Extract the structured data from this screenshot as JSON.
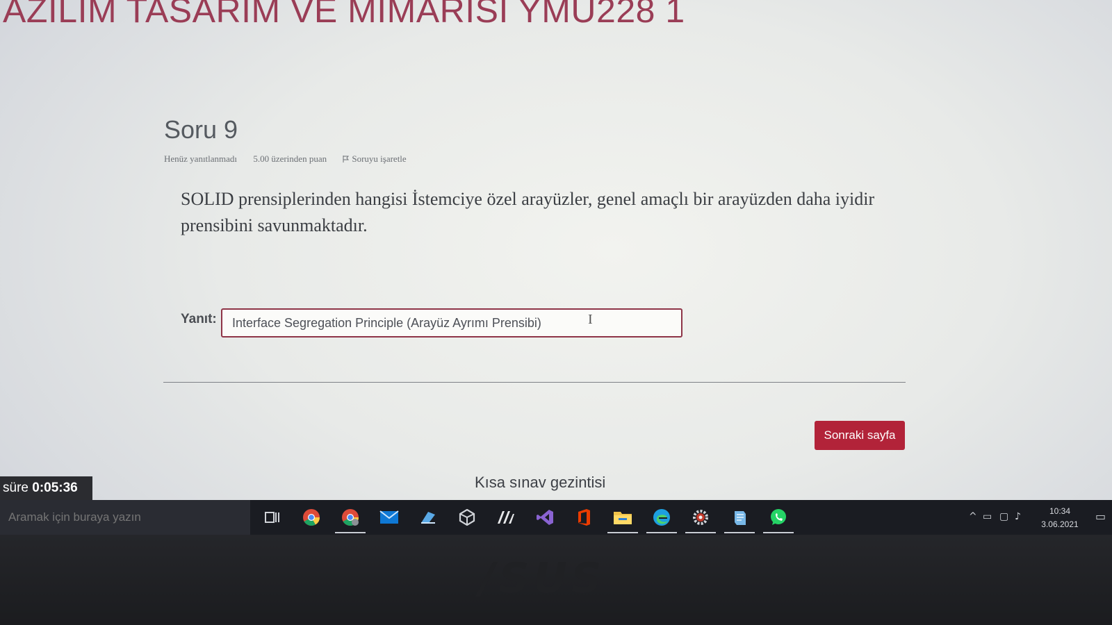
{
  "course": {
    "title": "AZILIM TASARIM VE MIMARISI YMU228 1"
  },
  "question": {
    "heading": "Soru 9",
    "status": "Henüz yanıtlanmadı",
    "points": "5.00 üzerinden puan",
    "flag_label": "Soruyu işaretle",
    "text": "SOLID prensiplerinden hangisi İstemciye özel arayüzler, genel amaçlı bir arayüzden daha iyidir prensibini savunmaktadır.",
    "answer_label": "Yanıt:",
    "answer_value": "Interface Segregation Principle (Arayüz Ayrımı Prensibi)"
  },
  "navigation": {
    "next_button": "Sonraki sayfa",
    "quiz_nav": "Kısa sınav gezintisi"
  },
  "timer": {
    "label": "süre",
    "value": "0:05:36"
  },
  "taskbar": {
    "search_placeholder": "Aramak için buraya yazın",
    "icons": [
      "task-view-icon",
      "chrome-icon",
      "chrome-profile-icon",
      "mail-icon",
      "app-icon",
      "unity-icon",
      "matlab-icon",
      "visual-studio-icon",
      "office-icon",
      "file-explorer-icon",
      "edge-icon",
      "settings-gear-icon",
      "notepad-icon",
      "whatsapp-icon"
    ],
    "clock": {
      "time": "10:34",
      "date": "3.06.2021"
    }
  },
  "colors": {
    "brand": "#9a3d56",
    "button": "#b22339",
    "input_border": "#8e3447",
    "taskbar": "#1a1c22"
  }
}
